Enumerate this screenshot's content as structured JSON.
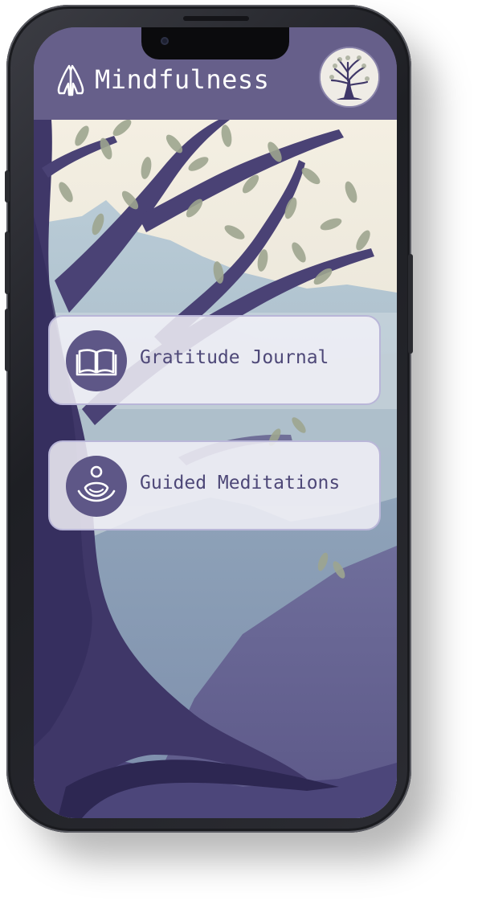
{
  "app": {
    "title": "Mindfulness",
    "brand_icon": "praying-hands-icon",
    "avatar": "tree-avatar"
  },
  "menu": [
    {
      "label": "Gratitude Journal",
      "icon": "open-book-icon"
    },
    {
      "label": "Guided Meditations",
      "icon": "meditating-person-icon"
    }
  ],
  "colors": {
    "header": "#665f8a",
    "accent": "#5e5787",
    "card_text": "#4e4878",
    "card_bg": "#f1f0f7"
  }
}
